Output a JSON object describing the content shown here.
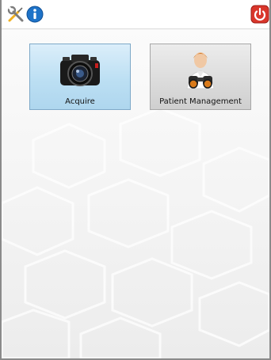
{
  "toolbar": {
    "settings_icon": "wrench-screwdriver-icon",
    "info_icon": "info-icon",
    "power_icon": "power-icon"
  },
  "tiles": [
    {
      "label": "Acquire",
      "icon": "camera-icon"
    },
    {
      "label": "Patient Management",
      "icon": "patient-binoculars-icon"
    }
  ],
  "colors": {
    "info_blue": "#1e73c8",
    "power_red": "#d9362b",
    "acquire_tile": "#bcdff3",
    "patient_tile": "#dcdcdc"
  }
}
